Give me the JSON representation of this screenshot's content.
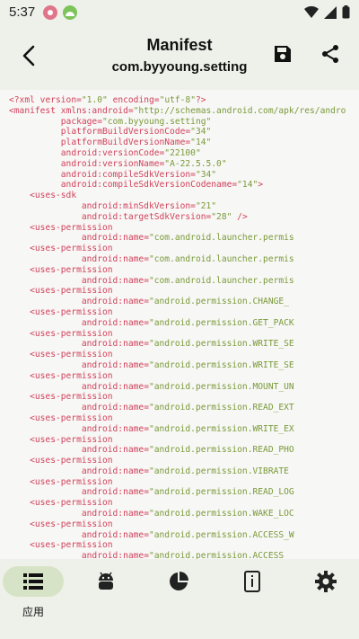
{
  "status": {
    "time": "5:37"
  },
  "toolbar": {
    "title": "Manifest",
    "subtitle": "com.byyoung.setting"
  },
  "code_lines": [
    "<?xml version=\"1.0\" encoding=\"utf-8\"?>",
    "<manifest xmlns:android=\"http://schemas.android.com/apk/res/andro",
    "          package=\"com.byyoung.setting\"",
    "          platformBuildVersionCode=\"34\"",
    "          platformBuildVersionName=\"14\"",
    "          android:versionCode=\"22100\"",
    "          android:versionName=\"A-22.5.5.0\"",
    "          android:compileSdkVersion=\"34\"",
    "          android:compileSdkVersionCodename=\"14\">",
    "    <uses-sdk",
    "              android:minSdkVersion=\"21\"",
    "              android:targetSdkVersion=\"28\" />",
    "    <uses-permission",
    "              android:name=\"com.android.launcher.permis",
    "    <uses-permission",
    "              android:name=\"com.android.launcher.permis",
    "    <uses-permission",
    "              android:name=\"com.android.launcher.permis",
    "    <uses-permission",
    "              android:name=\"android.permission.CHANGE_",
    "    <uses-permission",
    "              android:name=\"android.permission.GET_PACK",
    "    <uses-permission",
    "              android:name=\"android.permission.WRITE_SE",
    "    <uses-permission",
    "              android:name=\"android.permission.WRITE_SE",
    "    <uses-permission",
    "              android:name=\"android.permission.MOUNT_UN",
    "    <uses-permission",
    "              android:name=\"android.permission.READ_EXT",
    "    <uses-permission",
    "              android:name=\"android.permission.WRITE_EX",
    "    <uses-permission",
    "              android:name=\"android.permission.READ_PHO",
    "    <uses-permission",
    "              android:name=\"android.permission.VIBRATE",
    "    <uses-permission",
    "              android:name=\"android.permission.READ_LOG",
    "    <uses-permission",
    "              android:name=\"android.permission.WAKE_LOC",
    "    <uses-permission",
    "              android:name=\"android.permission.ACCESS_W",
    "    <uses-permission",
    "              android:name=\"android.permission.ACCESS_"
  ],
  "bottom_nav": [
    {
      "id": "apps",
      "label": "应用",
      "icon": "list-icon",
      "active": true
    },
    {
      "id": "android",
      "label": "",
      "icon": "android-icon",
      "active": false
    },
    {
      "id": "stats",
      "label": "",
      "icon": "pie-chart-icon",
      "active": false
    },
    {
      "id": "device",
      "label": "",
      "icon": "device-info-icon",
      "active": false
    },
    {
      "id": "settings",
      "label": "",
      "icon": "settings-gear-icon",
      "active": false
    }
  ]
}
